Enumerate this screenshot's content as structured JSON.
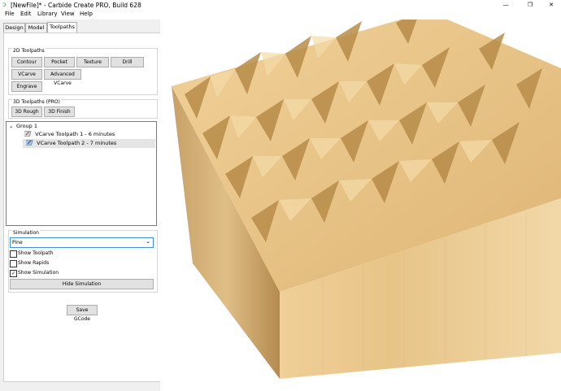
{
  "window": {
    "title": "[NewFile]* - Carbide Create PRO, Build 628",
    "minimize": "—",
    "maximize": "❐",
    "close": "✕"
  },
  "menu": [
    "File",
    "Edit",
    "Library",
    "View",
    "Help"
  ],
  "tabs": [
    {
      "label": "Design",
      "active": false
    },
    {
      "label": "Model",
      "active": false
    },
    {
      "label": "Toolpaths",
      "active": true
    }
  ],
  "toolpaths_2d": {
    "title": "2D Toolpaths",
    "buttons": [
      "Contour",
      "Pocket",
      "Texture",
      "Drill",
      "VCarve",
      "Advanced VCarve",
      "Engrave"
    ]
  },
  "toolpaths_3d": {
    "title": "3D Toolpaths (PRO)",
    "buttons": [
      "3D Rough",
      "3D Finish"
    ]
  },
  "tree": {
    "group_label": "Group 1",
    "expander": "⌄",
    "items": [
      {
        "label": "VCarve Toolpath 1 - 6 minutes",
        "selected": false
      },
      {
        "label": "VCarve Toolpath 2 - 7 minutes",
        "selected": true
      }
    ]
  },
  "simulation": {
    "title": "Simulation",
    "material": "Pine",
    "dropdown_glyph": "⌄",
    "checkboxes": [
      {
        "label": "Show Toolpath",
        "checked": false
      },
      {
        "label": "Show Rapids",
        "checked": false
      },
      {
        "label": "Show Simulation",
        "checked": true
      }
    ],
    "check_mark": "✓",
    "hide_button": "Hide Simulation"
  },
  "save_button": "Save GCode",
  "colors": {
    "accent": "#3c91d8",
    "selection": "#e5e5e5",
    "wood_light": "#f0cf98",
    "wood_mid": "#dcb36e",
    "wood_dark": "#b48a44"
  }
}
